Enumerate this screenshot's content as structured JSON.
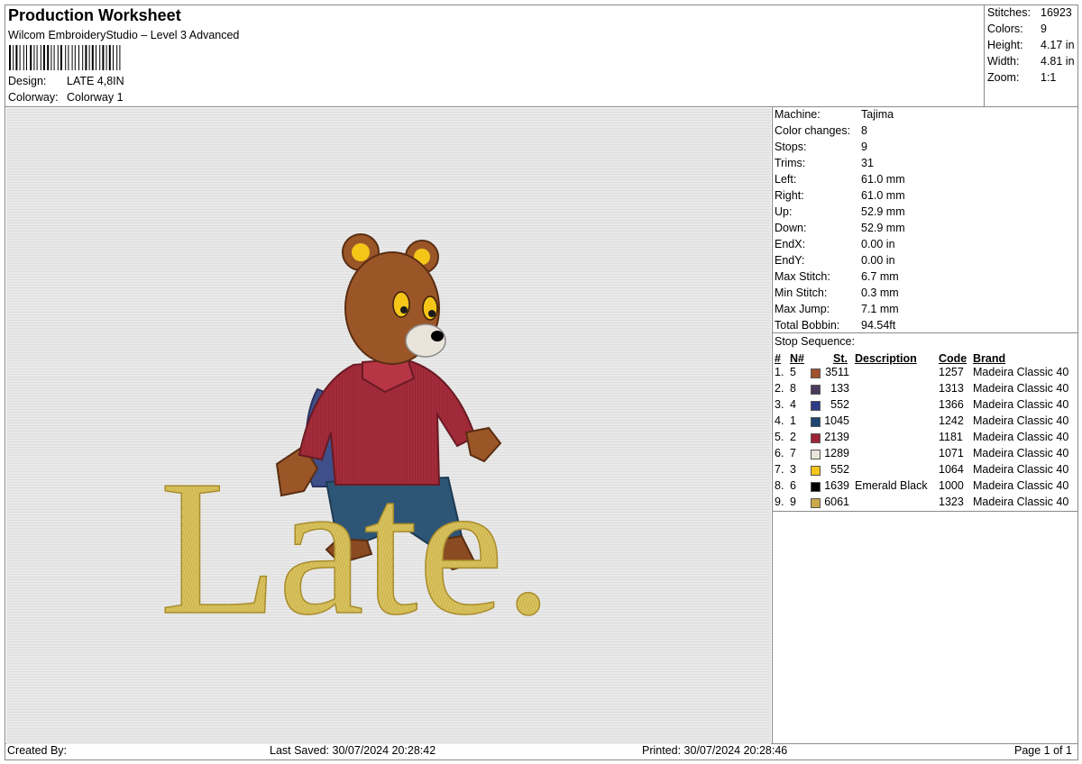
{
  "header": {
    "title": "Production Worksheet",
    "subtitle": "Wilcom EmbroideryStudio – Level 3 Advanced",
    "design_label": "Design:",
    "design_value": "LATE 4,8IN",
    "colorway_label": "Colorway:",
    "colorway_value": "Colorway 1"
  },
  "summary": [
    {
      "label": "Stitches:",
      "value": "16923"
    },
    {
      "label": "Colors:",
      "value": "9"
    },
    {
      "label": "Height:",
      "value": "4.17 in"
    },
    {
      "label": "Width:",
      "value": "4.81 in"
    },
    {
      "label": "Zoom:",
      "value": "1:1"
    }
  ],
  "machine_info": [
    {
      "label": "Machine:",
      "value": "Tajima"
    },
    {
      "label": "Color changes:",
      "value": "8"
    },
    {
      "label": "Stops:",
      "value": "9"
    },
    {
      "label": "Trims:",
      "value": "31"
    },
    {
      "label": "Left:",
      "value": "61.0 mm"
    },
    {
      "label": "Right:",
      "value": "61.0 mm"
    },
    {
      "label": "Up:",
      "value": "52.9 mm"
    },
    {
      "label": "Down:",
      "value": "52.9 mm"
    },
    {
      "label": "EndX:",
      "value": "0.00 in"
    },
    {
      "label": "EndY:",
      "value": "0.00 in"
    },
    {
      "label": "Max Stitch:",
      "value": "6.7 mm"
    },
    {
      "label": "Min Stitch:",
      "value": "0.3 mm"
    },
    {
      "label": "Max Jump:",
      "value": "7.1 mm"
    },
    {
      "label": "Total Bobbin:",
      "value": "94.54ft"
    }
  ],
  "stop_sequence": {
    "title": "Stop Sequence:",
    "columns": {
      "num": "#",
      "n": "N#",
      "st": "St.",
      "desc": "Description",
      "code": "Code",
      "brand": "Brand"
    },
    "rows": [
      {
        "num": "1.",
        "n": "5",
        "color": "#a0522d",
        "st": "3511",
        "desc": "",
        "code": "1257",
        "brand": "Madeira Classic 40"
      },
      {
        "num": "2.",
        "n": "8",
        "color": "#4b3a5e",
        "st": "133",
        "desc": "",
        "code": "1313",
        "brand": "Madeira Classic 40"
      },
      {
        "num": "3.",
        "n": "4",
        "color": "#2e3a86",
        "st": "552",
        "desc": "",
        "code": "1366",
        "brand": "Madeira Classic 40"
      },
      {
        "num": "4.",
        "n": "1",
        "color": "#1f4470",
        "st": "1045",
        "desc": "",
        "code": "1242",
        "brand": "Madeira Classic 40"
      },
      {
        "num": "5.",
        "n": "2",
        "color": "#9b2335",
        "st": "2139",
        "desc": "",
        "code": "1181",
        "brand": "Madeira Classic 40"
      },
      {
        "num": "6.",
        "n": "7",
        "color": "#e8e4da",
        "st": "1289",
        "desc": "",
        "code": "1071",
        "brand": "Madeira Classic 40"
      },
      {
        "num": "7.",
        "n": "3",
        "color": "#f5c518",
        "st": "552",
        "desc": "",
        "code": "1064",
        "brand": "Madeira Classic 40"
      },
      {
        "num": "8.",
        "n": "6",
        "color": "#000000",
        "st": "1639",
        "desc": "Emerald Black",
        "code": "1000",
        "brand": "Madeira Classic 40"
      },
      {
        "num": "9.",
        "n": "9",
        "color": "#c9a94a",
        "st": "6061",
        "desc": "",
        "code": "1323",
        "brand": "Madeira Classic 40"
      }
    ]
  },
  "design_preview": {
    "text": "Late."
  },
  "footer": {
    "created_by": "Created By:",
    "last_saved": "Last Saved: 30/07/2024 20:28:42",
    "printed": "Printed: 30/07/2024 20:28:46",
    "page": "Page 1 of 1"
  }
}
